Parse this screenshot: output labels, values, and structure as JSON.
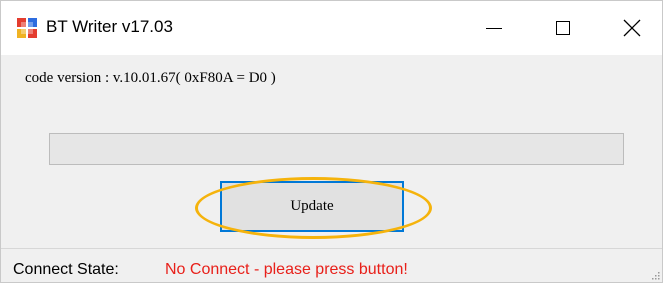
{
  "window": {
    "title": "BT Writer v17.03",
    "icon": "app-icon",
    "controls": {
      "minimize_icon": "minimize-icon",
      "maximize_icon": "maximize-icon",
      "close_icon": "close-icon"
    }
  },
  "main": {
    "code_version": "code version : v.10.01.67( 0xF80A = D0 )",
    "progress": {
      "value_percent": 0,
      "fill_color": "#06b025"
    },
    "update_button_label": "Update",
    "highlight_color": "#f5b30c"
  },
  "status": {
    "label": "Connect State:",
    "value": "No Connect - please press button!",
    "value_color": "#e8201a"
  }
}
